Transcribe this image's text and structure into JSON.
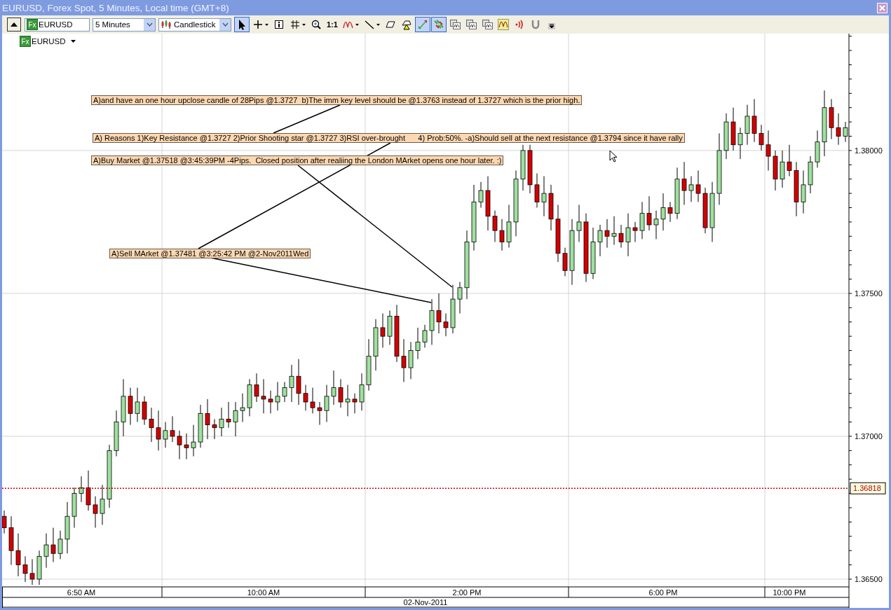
{
  "window": {
    "title": "EURUSD, Forex Spot, 5 Minutes, Local time (GMT+8)"
  },
  "toolbar": {
    "badge": "Fx",
    "instrument": "EURUSD",
    "period": "5 Minutes",
    "chart_type": "Candlestick",
    "tools": [
      {
        "kind": "pointer",
        "selected": true,
        "dropdown": false
      },
      {
        "kind": "crosshair",
        "selected": false,
        "dropdown": true
      },
      {
        "kind": "info",
        "selected": false,
        "dropdown": false
      },
      {
        "kind": "grid",
        "selected": false,
        "dropdown": true
      },
      {
        "kind": "zoom",
        "selected": false,
        "dropdown": false
      },
      {
        "kind": "text",
        "label": "1:1",
        "selected": false,
        "dropdown": false
      },
      {
        "kind": "indicator",
        "selected": false,
        "dropdown": true
      },
      {
        "kind": "line",
        "selected": false,
        "dropdown": true
      },
      {
        "kind": "eraser",
        "selected": false,
        "dropdown": false
      },
      {
        "kind": "alert",
        "selected": false,
        "dropdown": false
      },
      {
        "kind": "autoscale",
        "selected": true,
        "dropdown": false
      },
      {
        "kind": "shift",
        "selected": true,
        "dropdown": false
      },
      {
        "kind": "template",
        "selected": false,
        "dropdown": false
      },
      {
        "kind": "template",
        "selected": false,
        "dropdown": false
      },
      {
        "kind": "template",
        "selected": false,
        "dropdown": false
      },
      {
        "kind": "oscillator",
        "selected": false,
        "dropdown": false
      },
      {
        "kind": "signal",
        "selected": false,
        "dropdown": false
      },
      {
        "kind": "magnet",
        "selected": false,
        "dropdown": false
      },
      {
        "kind": "overflow",
        "selected": false,
        "dropdown": false
      }
    ]
  },
  "legend": {
    "badge": "Fx",
    "instrument": "EURUSD"
  },
  "chart": {
    "chart_data": {
      "type": "candlestick",
      "ylim": [
        1.36473,
        1.38409
      ],
      "grid": true,
      "yticks": [
        {
          "value": 1.365,
          "label": "1.36500"
        },
        {
          "value": 1.37,
          "label": "1.37000"
        },
        {
          "value": 1.375,
          "label": "1.37500"
        },
        {
          "value": 1.38,
          "label": "1.38000"
        }
      ],
      "categories": [
        null,
        null,
        null,
        null,
        null,
        null,
        null,
        null,
        null,
        null,
        null,
        "6:50 AM",
        null,
        null,
        null,
        null,
        null,
        null,
        null,
        null,
        null,
        null,
        null,
        null,
        null,
        null,
        null,
        null,
        null,
        null,
        null,
        null,
        null,
        null,
        null,
        null,
        null,
        "10:00 AM",
        null,
        null,
        null,
        null,
        null,
        null,
        null,
        null,
        null,
        null,
        null,
        null,
        null,
        null,
        null,
        null,
        null,
        null,
        null,
        null,
        null,
        null,
        null,
        null,
        null,
        null,
        null,
        null,
        "2:00 PM",
        null,
        null,
        null,
        null,
        null,
        null,
        null,
        null,
        null,
        null,
        null,
        null,
        null,
        null,
        null,
        null,
        null,
        null,
        null,
        null,
        null,
        null,
        null,
        null,
        null,
        null,
        null,
        "6:00 PM",
        null,
        null,
        null,
        null,
        null,
        null,
        null,
        null,
        null,
        null,
        null,
        null,
        null,
        null,
        null,
        null,
        null,
        "10:00 PM",
        null,
        null,
        null,
        null,
        null,
        null,
        null,
        null
      ],
      "xlabel": "02-Nov-2011",
      "ref_lines": [
        {
          "axis": "y",
          "value": 1.36818,
          "label": "1.36818",
          "color": "#cc0000"
        }
      ],
      "ohlc": [
        [
          1.3672,
          1.3674,
          1.3666,
          1.3668
        ],
        [
          1.3668,
          1.3672,
          1.3655,
          1.366
        ],
        [
          1.366,
          1.3666,
          1.3651,
          1.3655
        ],
        [
          1.3655,
          1.3658,
          1.3649,
          1.3652
        ],
        [
          1.3652,
          1.3657,
          1.3648,
          1.365
        ],
        [
          1.365,
          1.366,
          1.3648,
          1.3658
        ],
        [
          1.3658,
          1.3666,
          1.3654,
          1.3662
        ],
        [
          1.3662,
          1.3668,
          1.3656,
          1.3659
        ],
        [
          1.3659,
          1.3667,
          1.3657,
          1.3664
        ],
        [
          1.3664,
          1.3677,
          1.3659,
          1.3672
        ],
        [
          1.3672,
          1.3682,
          1.3668,
          1.368
        ],
        [
          1.368,
          1.3686,
          1.3677,
          1.3682
        ],
        [
          1.3682,
          1.3688,
          1.3674,
          1.3676
        ],
        [
          1.3676,
          1.3679,
          1.3668,
          1.3673
        ],
        [
          1.3673,
          1.3683,
          1.3669,
          1.3678
        ],
        [
          1.3678,
          1.3697,
          1.3675,
          1.3695
        ],
        [
          1.3695,
          1.3709,
          1.3693,
          1.3705
        ],
        [
          1.3705,
          1.372,
          1.37,
          1.3714
        ],
        [
          1.3714,
          1.3717,
          1.3704,
          1.3708
        ],
        [
          1.3708,
          1.3717,
          1.3705,
          1.3712
        ],
        [
          1.3712,
          1.3714,
          1.3704,
          1.3706
        ],
        [
          1.3706,
          1.371,
          1.3698,
          1.3703
        ],
        [
          1.3703,
          1.3709,
          1.3695,
          1.3699
        ],
        [
          1.3699,
          1.3705,
          1.3696,
          1.3702
        ],
        [
          1.3702,
          1.3707,
          1.3698,
          1.37
        ],
        [
          1.37,
          1.3702,
          1.3692,
          1.3697
        ],
        [
          1.3697,
          1.3701,
          1.3692,
          1.3696
        ],
        [
          1.3696,
          1.3704,
          1.3693,
          1.3698
        ],
        [
          1.3698,
          1.3711,
          1.3696,
          1.3708
        ],
        [
          1.3708,
          1.3713,
          1.3699,
          1.3704
        ],
        [
          1.3704,
          1.3706,
          1.3699,
          1.3703
        ],
        [
          1.3703,
          1.371,
          1.37,
          1.3706
        ],
        [
          1.3706,
          1.3712,
          1.3703,
          1.3705
        ],
        [
          1.3705,
          1.3712,
          1.37,
          1.3709
        ],
        [
          1.3709,
          1.3715,
          1.3705,
          1.371
        ],
        [
          1.371,
          1.372,
          1.3707,
          1.3718
        ],
        [
          1.3718,
          1.3722,
          1.3712,
          1.3714
        ],
        [
          1.3714,
          1.372,
          1.3708,
          1.3713
        ],
        [
          1.3713,
          1.3716,
          1.3708,
          1.3712
        ],
        [
          1.3712,
          1.3719,
          1.3709,
          1.3714
        ],
        [
          1.3714,
          1.3719,
          1.3712,
          1.3717
        ],
        [
          1.3717,
          1.3725,
          1.3712,
          1.3721
        ],
        [
          1.3721,
          1.3727,
          1.3711,
          1.3715
        ],
        [
          1.3715,
          1.3718,
          1.3709,
          1.3712
        ],
        [
          1.3712,
          1.3717,
          1.3708,
          1.371
        ],
        [
          1.371,
          1.3712,
          1.3704,
          1.3709
        ],
        [
          1.3709,
          1.3718,
          1.3705,
          1.3714
        ],
        [
          1.3714,
          1.3723,
          1.3711,
          1.3717
        ],
        [
          1.3717,
          1.372,
          1.371,
          1.3712
        ],
        [
          1.3712,
          1.3718,
          1.3707,
          1.3713
        ],
        [
          1.3713,
          1.3715,
          1.3708,
          1.3712
        ],
        [
          1.3712,
          1.3722,
          1.3709,
          1.3718
        ],
        [
          1.3718,
          1.3734,
          1.3716,
          1.3728
        ],
        [
          1.3728,
          1.3741,
          1.3723,
          1.3738
        ],
        [
          1.3738,
          1.3743,
          1.3731,
          1.3735
        ],
        [
          1.3735,
          1.3744,
          1.3732,
          1.3742
        ],
        [
          1.3742,
          1.3746,
          1.3726,
          1.3728
        ],
        [
          1.3728,
          1.3734,
          1.3719,
          1.3724
        ],
        [
          1.3724,
          1.3733,
          1.372,
          1.373
        ],
        [
          1.373,
          1.3738,
          1.3727,
          1.3733
        ],
        [
          1.3733,
          1.3739,
          1.3731,
          1.3737
        ],
        [
          1.3737,
          1.3748,
          1.3732,
          1.3744
        ],
        [
          1.3744,
          1.375,
          1.3736,
          1.374
        ],
        [
          1.374,
          1.3743,
          1.3735,
          1.3738
        ],
        [
          1.3738,
          1.3753,
          1.3736,
          1.3748
        ],
        [
          1.3748,
          1.3754,
          1.3743,
          1.3752
        ],
        [
          1.3752,
          1.3772,
          1.3748,
          1.3768
        ],
        [
          1.3768,
          1.3788,
          1.3765,
          1.3782
        ],
        [
          1.3782,
          1.3789,
          1.378,
          1.3786
        ],
        [
          1.3786,
          1.3791,
          1.3772,
          1.3777
        ],
        [
          1.3777,
          1.3779,
          1.3768,
          1.3772
        ],
        [
          1.3772,
          1.3776,
          1.3765,
          1.3768
        ],
        [
          1.3768,
          1.3781,
          1.3766,
          1.3775
        ],
        [
          1.3775,
          1.3793,
          1.377,
          1.379
        ],
        [
          1.379,
          1.3802,
          1.3786,
          1.38
        ],
        [
          1.38,
          1.3802,
          1.3785,
          1.3788
        ],
        [
          1.3788,
          1.3792,
          1.378,
          1.3782
        ],
        [
          1.3782,
          1.3791,
          1.3777,
          1.3785
        ],
        [
          1.3785,
          1.3788,
          1.3772,
          1.3776
        ],
        [
          1.3776,
          1.3781,
          1.3761,
          1.3764
        ],
        [
          1.3764,
          1.3766,
          1.3756,
          1.3758
        ],
        [
          1.3758,
          1.3776,
          1.3753,
          1.3772
        ],
        [
          1.3772,
          1.3781,
          1.3768,
          1.3775
        ],
        [
          1.3775,
          1.3778,
          1.3754,
          1.3757
        ],
        [
          1.3757,
          1.3773,
          1.3755,
          1.3768
        ],
        [
          1.3768,
          1.3774,
          1.3763,
          1.3772
        ],
        [
          1.3772,
          1.3776,
          1.3766,
          1.377
        ],
        [
          1.377,
          1.3777,
          1.3767,
          1.3771
        ],
        [
          1.3771,
          1.3774,
          1.3766,
          1.3768
        ],
        [
          1.3768,
          1.3778,
          1.3763,
          1.3773
        ],
        [
          1.3773,
          1.3775,
          1.3768,
          1.3772
        ],
        [
          1.3772,
          1.3782,
          1.3769,
          1.3778
        ],
        [
          1.3778,
          1.3784,
          1.3772,
          1.3774
        ],
        [
          1.3774,
          1.3779,
          1.3769,
          1.3776
        ],
        [
          1.3776,
          1.3785,
          1.3772,
          1.378
        ],
        [
          1.378,
          1.3782,
          1.3775,
          1.3778
        ],
        [
          1.3778,
          1.3794,
          1.3776,
          1.379
        ],
        [
          1.379,
          1.3796,
          1.3781,
          1.3786
        ],
        [
          1.3786,
          1.3791,
          1.3782,
          1.3788
        ],
        [
          1.3788,
          1.3793,
          1.3782,
          1.3785
        ],
        [
          1.3785,
          1.3787,
          1.3771,
          1.3773
        ],
        [
          1.3773,
          1.3789,
          1.3768,
          1.3785
        ],
        [
          1.3785,
          1.3806,
          1.3781,
          1.38
        ],
        [
          1.38,
          1.3813,
          1.3797,
          1.381
        ],
        [
          1.381,
          1.3815,
          1.38,
          1.3802
        ],
        [
          1.3802,
          1.3808,
          1.3797,
          1.3806
        ],
        [
          1.3806,
          1.3816,
          1.3802,
          1.3812
        ],
        [
          1.3812,
          1.3818,
          1.3803,
          1.3806
        ],
        [
          1.3806,
          1.3809,
          1.38,
          1.3802
        ],
        [
          1.3802,
          1.3807,
          1.3793,
          1.3798
        ],
        [
          1.3798,
          1.38,
          1.3786,
          1.379
        ],
        [
          1.379,
          1.38,
          1.3787,
          1.3796
        ],
        [
          1.3796,
          1.3802,
          1.3791,
          1.3793
        ],
        [
          1.3793,
          1.3796,
          1.3777,
          1.3782
        ],
        [
          1.3782,
          1.3793,
          1.3778,
          1.3788
        ],
        [
          1.3788,
          1.3798,
          1.3785,
          1.3796
        ],
        [
          1.3796,
          1.3807,
          1.3794,
          1.3803
        ],
        [
          1.3803,
          1.3821,
          1.3798,
          1.3815
        ],
        [
          1.3815,
          1.3818,
          1.3804,
          1.3808
        ],
        [
          1.3808,
          1.3813,
          1.3802,
          1.3805
        ],
        [
          1.3805,
          1.381,
          1.3803,
          1.3808
        ]
      ]
    },
    "notes": [
      {
        "text": "A)and have an one hour upclose candle of 28Pips @1.3727  b)The imm key level should be @1.3763 instead of 1.3727 which is the prior high."
      },
      {
        "text": "A) Reasons 1)Key Resistance @1.3727 2)Prior Shooting star @1.3727 3)RSI over-brought      4) Prob:50%. -a)Should sell at the next resistance @1.3794 since it have rally"
      },
      {
        "text": "A)Buy Market @1.37518 @3:45:39PM -4Pips.  Closed position after realiing the London MArket opens one hour later. :)"
      },
      {
        "text": "A)Sell MArket @1.37481 @3:25:42 PM @2-Nov2011Wed"
      }
    ]
  }
}
